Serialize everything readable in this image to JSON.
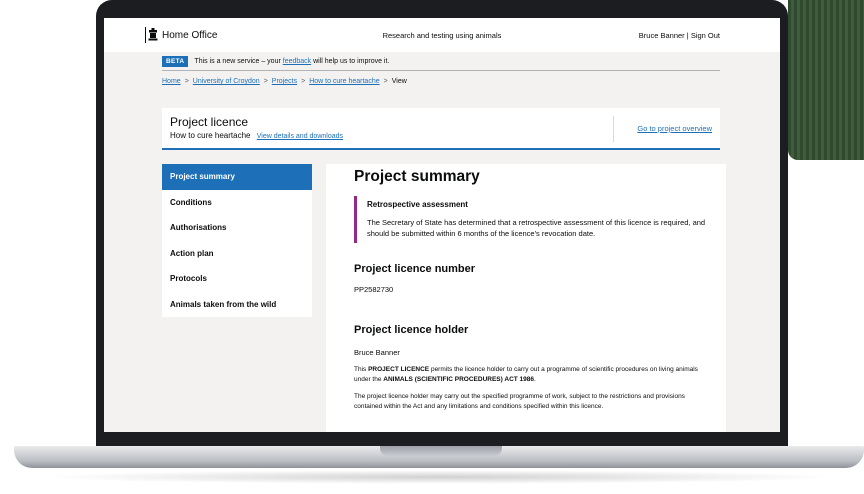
{
  "header": {
    "brand": "Home Office",
    "service_name": "Research and testing using animals",
    "user_name": "Bruce Banner",
    "separator": "|",
    "sign_out": "Sign Out"
  },
  "beta": {
    "tag": "BETA",
    "text_before": "This is a new service – your",
    "link": "feedback",
    "text_after": "will help us to improve it."
  },
  "breadcrumbs": {
    "items": [
      "Home",
      "University of Croydon",
      "Projects",
      "How to cure heartache"
    ],
    "current": "View",
    "separator": ">"
  },
  "licence": {
    "title": "Project licence",
    "subtitle": "How to cure heartache",
    "details_link": "View details and downloads",
    "overview_link": "Go to project overview"
  },
  "nav": {
    "items": [
      "Project summary",
      "Conditions",
      "Authorisations",
      "Action plan",
      "Protocols",
      "Animals taken from the wild"
    ],
    "active_index": 0
  },
  "content": {
    "heading": "Project summary",
    "inset_title": "Retrospective assessment",
    "inset_text": "The Secretary of State has determined that a retrospective assessment of this licence is required, and should be submitted within 6 months of the licence's revocation date.",
    "number_heading": "Project licence number",
    "number_value": "PP2582730",
    "holder_heading": "Project licence holder",
    "holder_value": "Bruce Banner",
    "para1_a": "This",
    "para1_b": "PROJECT LICENCE",
    "para1_c": "permits the licence holder to carry out a programme of scientific procedures on living animals under the",
    "para1_d": "ANIMALS (SCIENTIFIC PROCEDURES) ACT 1986",
    "para1_e": ".",
    "para2": "The project licence holder may carry out the specified programme of work, subject to the restrictions and provisions contained within the Act and any limitations and conditions specified within this licence."
  },
  "colors": {
    "link": "#1d70b8",
    "active_nav": "#1d70b8",
    "inset_border": "#912b88"
  }
}
